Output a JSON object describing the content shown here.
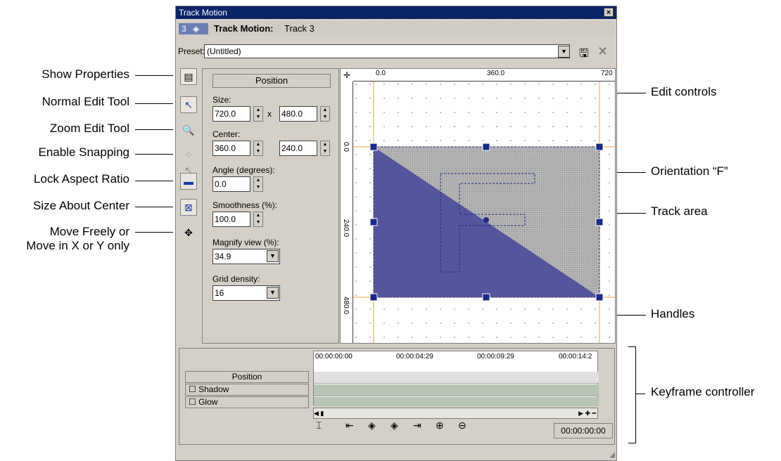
{
  "callouts": {
    "show_properties": "Show Properties",
    "normal_edit_tool": "Normal Edit Tool",
    "zoom_edit_tool": "Zoom Edit Tool",
    "enable_snapping": "Enable Snapping",
    "lock_aspect_ratio": "Lock Aspect Ratio",
    "size_about_center": "Size About Center",
    "move_freely_1": "Move Freely or",
    "move_freely_2": "Move in X or Y only",
    "edit_controls": "Edit controls",
    "orientation_f": "Orientation “F”",
    "track_area": "Track area",
    "handles": "Handles",
    "keyframe_controller": "Keyframe controller"
  },
  "window": {
    "title": "Track Motion",
    "close": "×",
    "track_number": "3",
    "track_label": "Track Motion:",
    "track_name": "Track 3",
    "preset_label": "Preset:",
    "preset_value": "(Untitled)"
  },
  "props": {
    "header": "Position",
    "size_label": "Size:",
    "size_w": "720.0",
    "size_x": "x",
    "size_h": "480.0",
    "center_label": "Center:",
    "center_x": "360.0",
    "center_y": "240.0",
    "angle_label": "Angle (degrees):",
    "angle": "0.0",
    "smooth_label": "Smoothness (%):",
    "smooth": "100.0",
    "magnify_label": "Magnify view (%):",
    "magnify": "34.9",
    "grid_label": "Grid density:",
    "grid": "16"
  },
  "rulers": {
    "top": [
      "0.0",
      "360.0",
      "720"
    ],
    "left": [
      "0.0",
      "240.0",
      "480.0"
    ]
  },
  "keyframes": {
    "rows": [
      "Position",
      "Shadow",
      "Glow"
    ],
    "times": [
      "00:00:00:00",
      "00:00:04:29",
      "00:00:09:29",
      "00:00:14:2"
    ],
    "timecode": "00:00:00:00"
  },
  "colors": {
    "track_fill": "#4a4a9a",
    "title_bar": "#0a246a",
    "handle": "#1a2a8a"
  }
}
